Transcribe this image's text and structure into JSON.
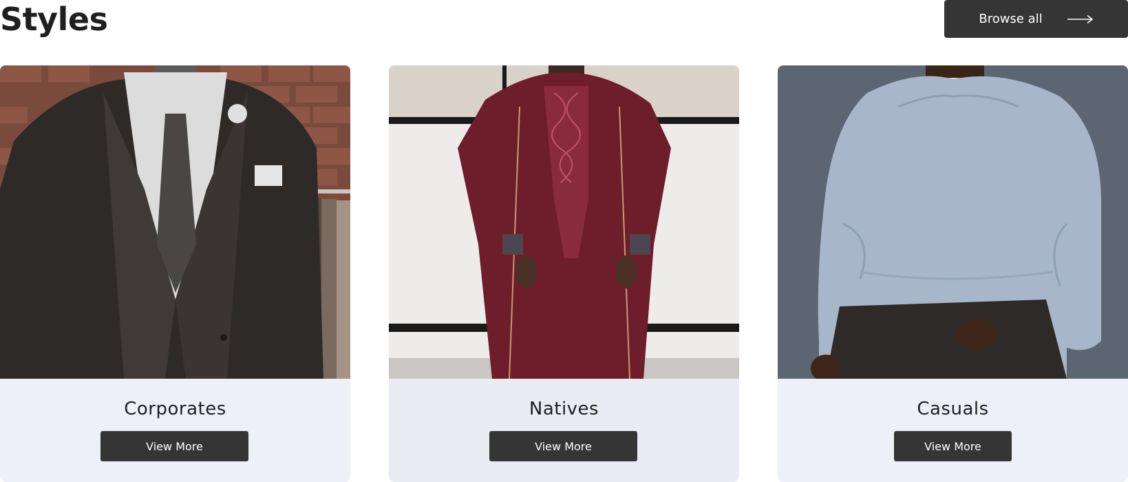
{
  "header": {
    "title": "Styles",
    "browse_label": "Browse all",
    "browse_icon": "long-arrow-right-icon"
  },
  "cards": [
    {
      "label": "Corporates",
      "button_label": "View More",
      "image_subject": "suit-jacket-photo"
    },
    {
      "label": "Natives",
      "button_label": "View More",
      "image_subject": "agbada-photo"
    },
    {
      "label": "Casuals",
      "button_label": "View More",
      "image_subject": "sweatshirt-photo"
    }
  ],
  "colors": {
    "button_bg": "#353535",
    "card_bg": "#eef0f8",
    "title_text": "#1f1f1f"
  }
}
